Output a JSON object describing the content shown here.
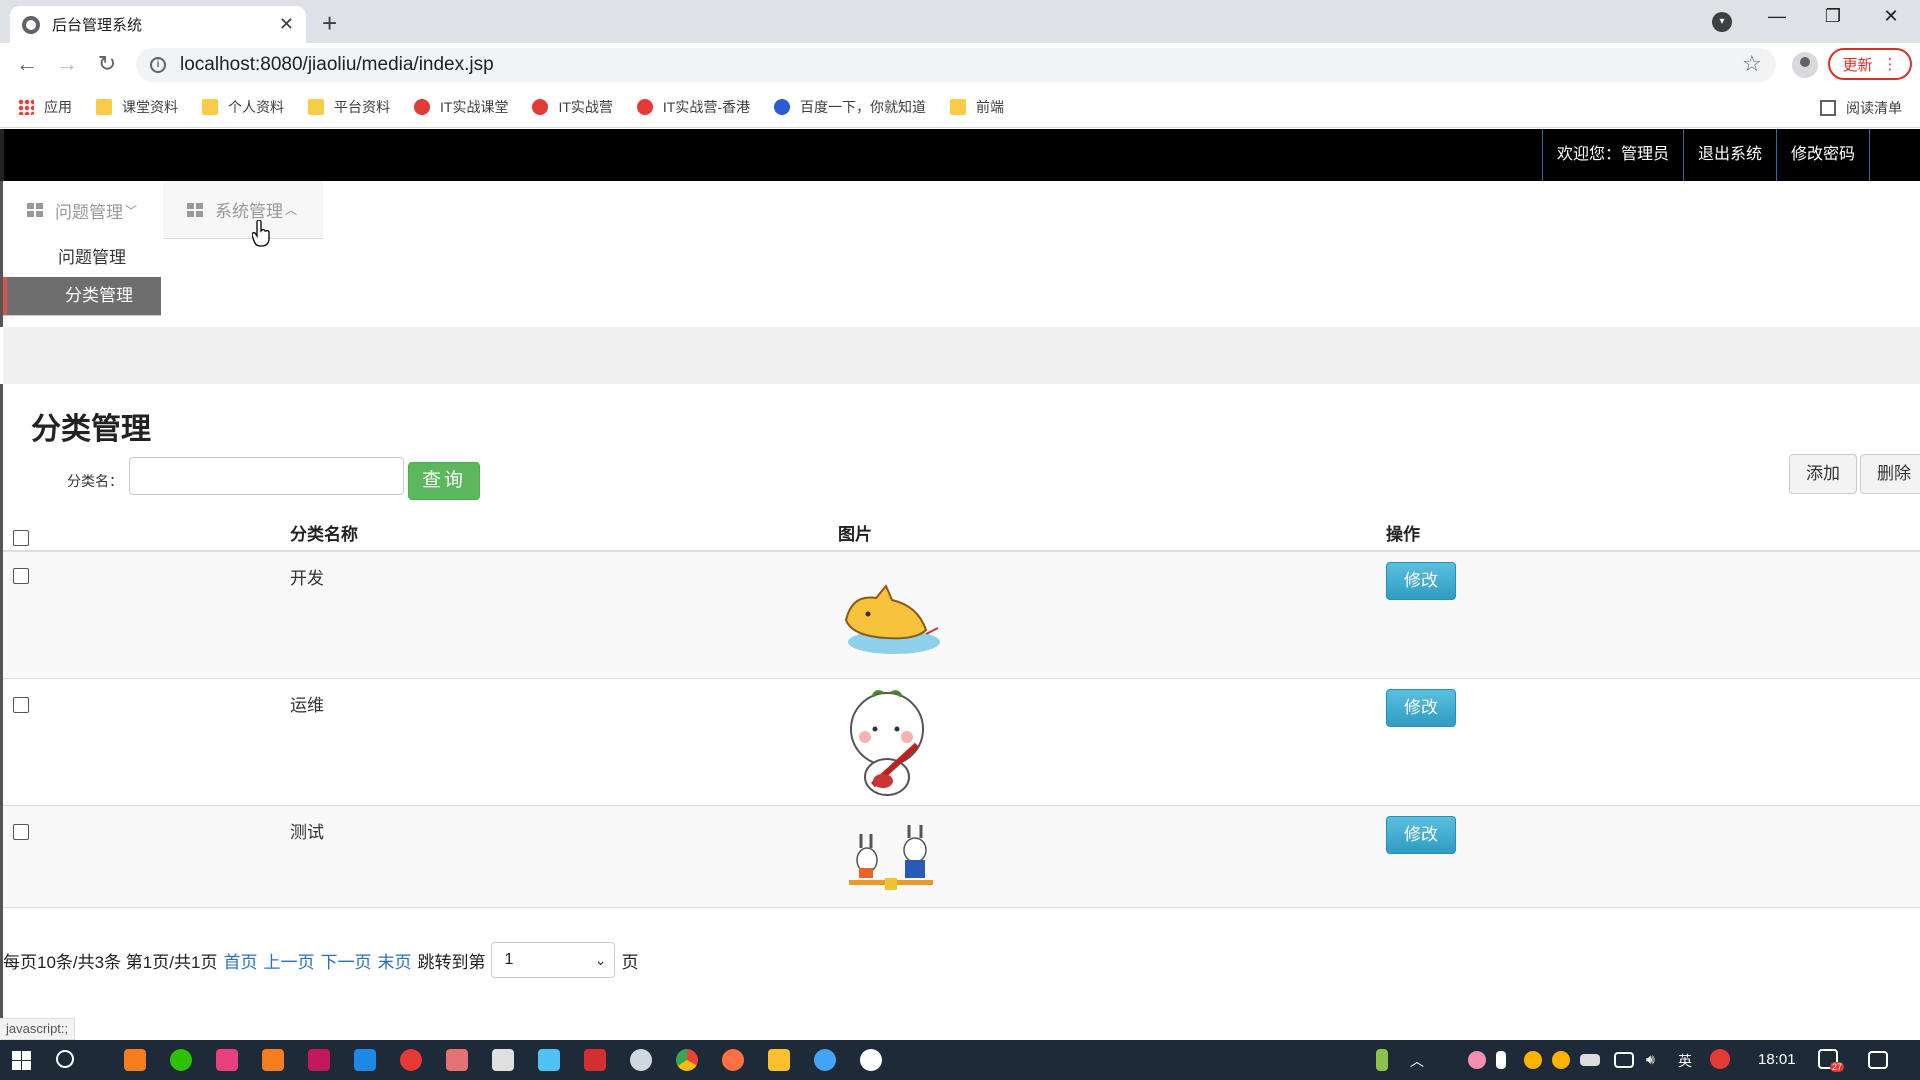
{
  "browser": {
    "tab_title": "后台管理系统",
    "url": "localhost:8080/jiaoliu/media/index.jsp",
    "update_label": "更新",
    "bookmarks": [
      "应用",
      "课堂资料",
      "个人资料",
      "平台资料",
      "IT实战课堂",
      "IT实战营",
      "IT实战营-香港",
      "百度一下，你就知道",
      "前端"
    ],
    "reading_list": "阅读清单"
  },
  "header": {
    "welcome": "欢迎您：管理员",
    "logout": "退出系统",
    "change_password": "修改密码"
  },
  "menu": {
    "items": [
      "问题管理",
      "系统管理"
    ],
    "submenu": [
      "问题管理",
      "分类管理"
    ]
  },
  "main": {
    "title": "分类管理",
    "search_label": "分类名：",
    "search_value": "",
    "query_button": "查询",
    "add_button": "添加",
    "delete_button": "删除",
    "columns": [
      "分类名称",
      "图片",
      "操作"
    ],
    "rows": [
      {
        "name": "开发",
        "edit": "修改"
      },
      {
        "name": "运维",
        "edit": "修改"
      },
      {
        "name": "测试",
        "edit": "修改"
      }
    ]
  },
  "pager": {
    "summary": "每页10条/共3条 第1页/共1页",
    "first": "首页",
    "prev": "上一页",
    "next": "下一页",
    "last": "末页",
    "jump_label": "跳转到第",
    "page_value": "1",
    "page_suffix": "页"
  },
  "status_bar": "javascript:;",
  "taskbar": {
    "time": "18:01",
    "ime": "英",
    "badge": "27"
  }
}
